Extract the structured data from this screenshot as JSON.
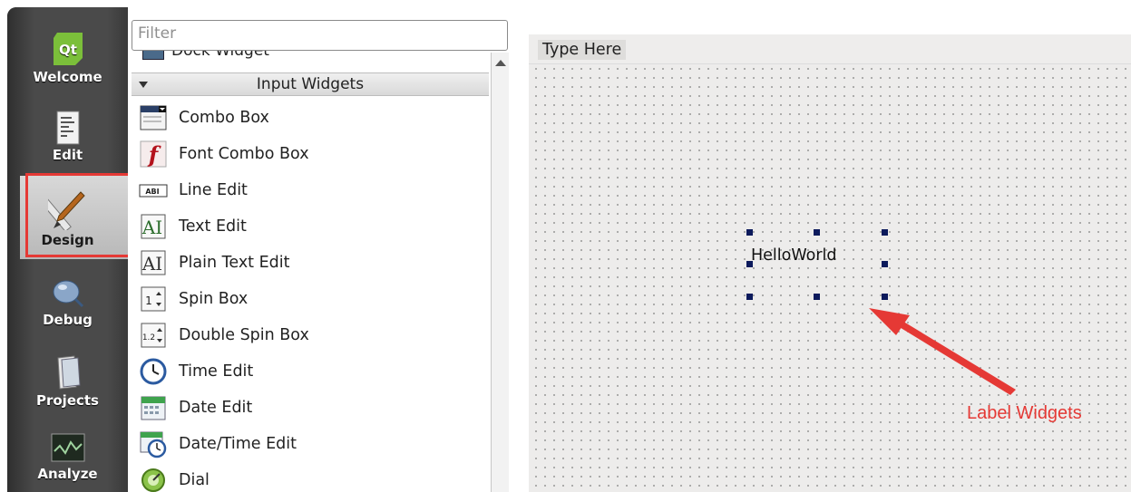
{
  "modes": {
    "welcome": "Welcome",
    "edit": "Edit",
    "design": "Design",
    "debug": "Debug",
    "projects": "Projects",
    "analyze": "Analyze",
    "logo": "Qt"
  },
  "widget_box": {
    "filter_placeholder": "Filter",
    "partial_item": "Dock Widget",
    "category": "Input Widgets",
    "items": [
      {
        "label": "Combo Box",
        "icon": "combo-box-icon"
      },
      {
        "label": "Font Combo Box",
        "icon": "font-combo-box-icon"
      },
      {
        "label": "Line Edit",
        "icon": "line-edit-icon"
      },
      {
        "label": "Text Edit",
        "icon": "text-edit-icon"
      },
      {
        "label": "Plain Text Edit",
        "icon": "plain-text-edit-icon"
      },
      {
        "label": "Spin Box",
        "icon": "spin-box-icon"
      },
      {
        "label": "Double Spin Box",
        "icon": "double-spin-box-icon"
      },
      {
        "label": "Time Edit",
        "icon": "time-edit-icon"
      },
      {
        "label": "Date Edit",
        "icon": "date-edit-icon"
      },
      {
        "label": "Date/Time Edit",
        "icon": "date-time-edit-icon"
      },
      {
        "label": "Dial",
        "icon": "dial-icon"
      }
    ]
  },
  "form": {
    "menu_placeholder": "Type Here",
    "label_text": "HelloWorld"
  },
  "annotation": {
    "text": "Label Widgets",
    "color": "#e53935"
  },
  "colors": {
    "highlight": "#e53935",
    "handle": "#0c1a5c",
    "sidebar": "#4a4a4a"
  }
}
